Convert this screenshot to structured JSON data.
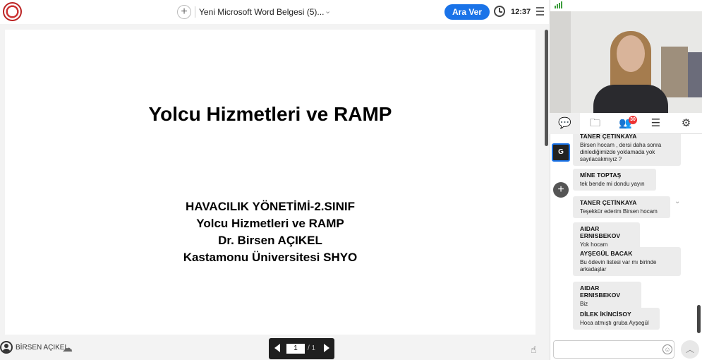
{
  "header": {
    "document_title": "Yeni Microsoft Word Belgesi (5)...",
    "break_button": "Ara Ver",
    "time": "12:37",
    "add_symbol": "+",
    "chevron": "⌄"
  },
  "slide": {
    "title": "Yolcu Hizmetleri ve RAMP",
    "lines": [
      "HAVACILIK YÖNETİMİ-2.SINIF",
      "Yolcu Hizmetleri ve RAMP",
      "Dr. Birsen AÇIKEL",
      "Kastamonu Üniversitesi SHYO"
    ]
  },
  "bottombar": {
    "presenter_name": "BİRSEN AÇIKEL",
    "page_current": "1",
    "page_total": "/ 1"
  },
  "panel": {
    "participants_badge": "30",
    "side_badge": "G",
    "side_add": "+",
    "chat_messages": [
      {
        "author": "TANER ÇETİNKAYA",
        "text": "Birsen hocam , dersi daha sonra dinlediğimizde yoklamada yok sayılacakmıyız ?"
      },
      {
        "author": "MİNE TOPTAŞ",
        "text": "tek bende mi dondu yayın"
      },
      {
        "author": "TANER ÇETİNKAYA",
        "text": "Teşekkür ederim Birsen hocam"
      },
      {
        "author": "AIDAR ERNISBEKOV",
        "text": "Yok hocam"
      },
      {
        "author": "AYŞEGÜL BACAK",
        "text": "Bu ödevin listesi var mı birinde arkadaşlar"
      },
      {
        "author": "AIDAR ERNISBEKOV",
        "text": "Biz"
      },
      {
        "author": "DİLEK İKİNCİSOY",
        "text": "Hoca atmıştı gruba Ayşegül"
      }
    ]
  },
  "colors": {
    "accent": "#1a73e8",
    "badge": "#ee3333"
  }
}
